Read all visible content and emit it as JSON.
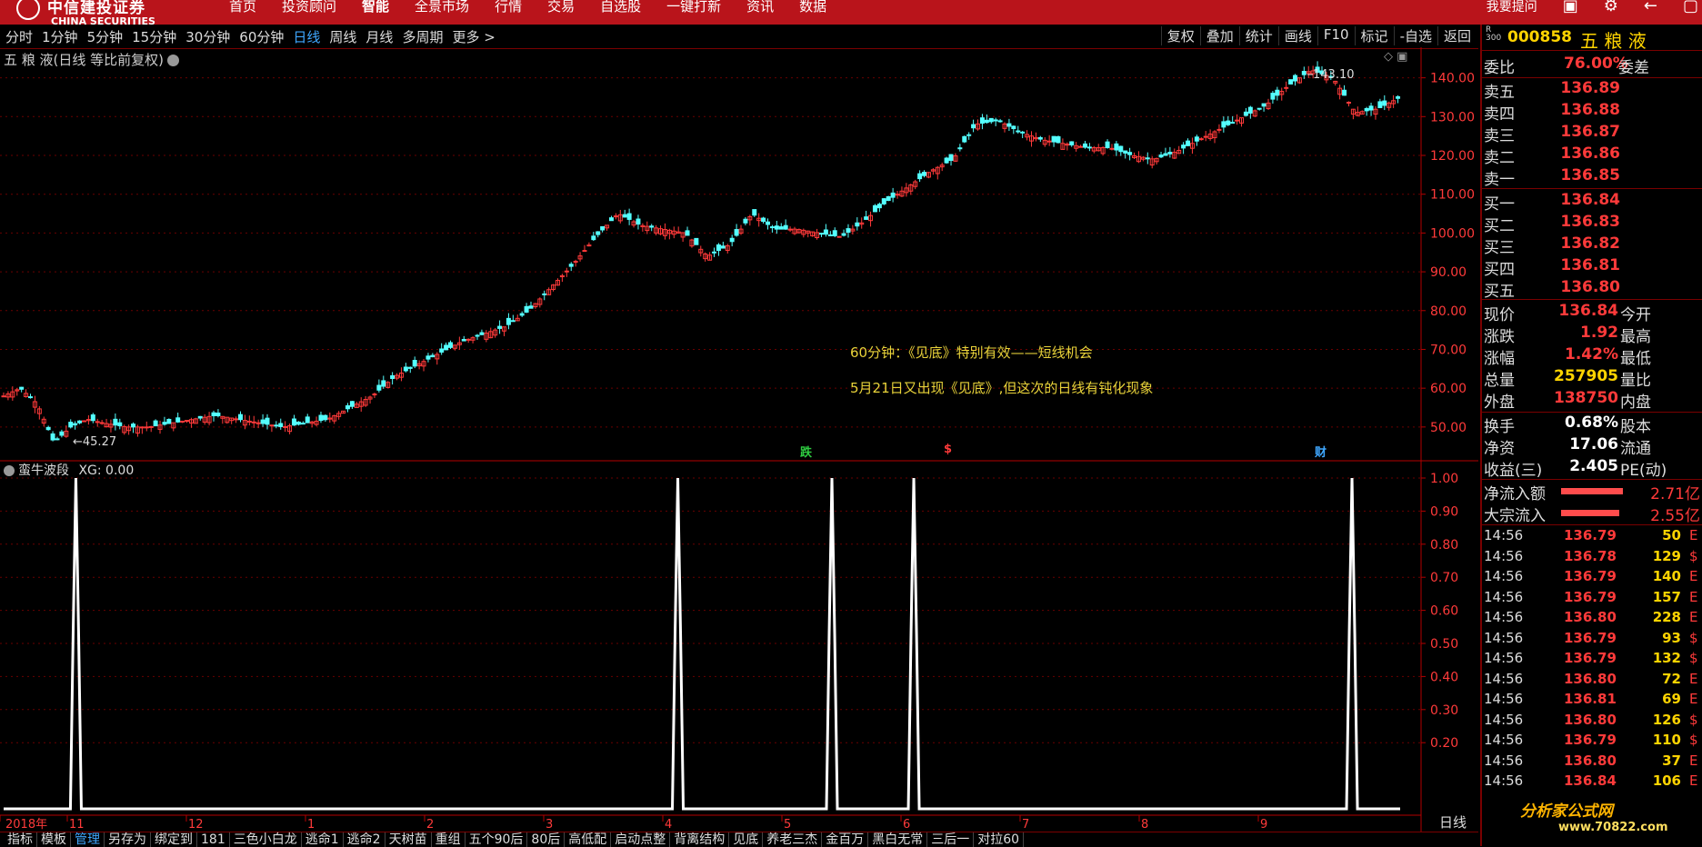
{
  "app": {
    "brand_cn": "中信建投证券",
    "brand_en": "CHINA SECURITIES",
    "menu": [
      "首页",
      "投资顾问",
      "智能",
      "全景市场",
      "行情",
      "交易",
      "自选股",
      "一键打新",
      "资讯",
      "数据"
    ],
    "help": "我要提问"
  },
  "toolbar": {
    "periods": [
      "分时",
      "1分钟",
      "5分钟",
      "15分钟",
      "30分钟",
      "60分钟",
      "日线",
      "周线",
      "月线",
      "多周期",
      "更多 >"
    ],
    "active_period": "日线",
    "right_tools": [
      "复权",
      "叠加",
      "统计",
      "画线",
      "F10",
      "标记",
      "-自选",
      "返回"
    ]
  },
  "chart": {
    "title": "五 粮 液(日线 等比前复权)",
    "price_axis": [
      "140.00",
      "130.00",
      "120.00",
      "110.00",
      "100.00",
      "90.00",
      "80.00",
      "70.00",
      "60.00",
      "50.00"
    ],
    "high_label": "143.10",
    "low_label": "45.27",
    "annotations": [
      "60分钟：《见底》特别有效——短线机会",
      "5月21日又出现《见底》,但这次的日线有钝化现象"
    ],
    "markers": [
      {
        "text": "跌",
        "color": "#2ecc40"
      },
      {
        "text": "$",
        "color": "#ff3a3a"
      },
      {
        "text": "财",
        "color": "#3fa7ff"
      }
    ],
    "date_axis": [
      "2018年",
      "11",
      "12",
      "1",
      "2",
      "3",
      "4",
      "5",
      "6",
      "7",
      "8",
      "9"
    ],
    "period_label": "日线"
  },
  "chart_data": [
    {
      "type": "candlestick",
      "title": "五 粮 液(日线 等比前复权)",
      "ylim": [
        42,
        146
      ],
      "x": [
        "2018-10",
        "2018-11",
        "2018-12",
        "2019-01",
        "2019-02",
        "2019-03",
        "2019-04",
        "2019-05",
        "2019-06",
        "2019-07",
        "2019-08",
        "2019-09"
      ],
      "close_path": [
        [
          0,
          58
        ],
        [
          3,
          60
        ],
        [
          6,
          56
        ],
        [
          9,
          46
        ],
        [
          12,
          50
        ],
        [
          15,
          52
        ],
        [
          18,
          51
        ],
        [
          22,
          50
        ],
        [
          26,
          50
        ],
        [
          30,
          51
        ],
        [
          34,
          52
        ],
        [
          38,
          53
        ],
        [
          42,
          52
        ],
        [
          46,
          51
        ],
        [
          50,
          50
        ],
        [
          54,
          51
        ],
        [
          58,
          52
        ],
        [
          62,
          55
        ],
        [
          66,
          58
        ],
        [
          70,
          63
        ],
        [
          74,
          66
        ],
        [
          78,
          69
        ],
        [
          82,
          72
        ],
        [
          86,
          74
        ],
        [
          90,
          76
        ],
        [
          94,
          80
        ],
        [
          98,
          86
        ],
        [
          102,
          92
        ],
        [
          106,
          99
        ],
        [
          110,
          105
        ],
        [
          114,
          102
        ],
        [
          118,
          101
        ],
        [
          122,
          100
        ],
        [
          126,
          94
        ],
        [
          130,
          97
        ],
        [
          134,
          105
        ],
        [
          138,
          101
        ],
        [
          142,
          101
        ],
        [
          146,
          100
        ],
        [
          150,
          99
        ],
        [
          154,
          103
        ],
        [
          158,
          108
        ],
        [
          162,
          112
        ],
        [
          166,
          116
        ],
        [
          170,
          119
        ],
        [
          174,
          128
        ],
        [
          178,
          129
        ],
        [
          182,
          126
        ],
        [
          186,
          124
        ],
        [
          190,
          123
        ],
        [
          194,
          122
        ],
        [
          198,
          122
        ],
        [
          202,
          120
        ],
        [
          206,
          119
        ],
        [
          210,
          121
        ],
        [
          214,
          124
        ],
        [
          218,
          127
        ],
        [
          222,
          130
        ],
        [
          226,
          133
        ],
        [
          230,
          138
        ],
        [
          234,
          142
        ],
        [
          238,
          140
        ],
        [
          242,
          131
        ],
        [
          246,
          132
        ],
        [
          250,
          135
        ]
      ]
    },
    {
      "type": "line",
      "name": "XG",
      "ylim": [
        0,
        1.0
      ],
      "spikes_at_x": [
        15,
        140,
        172,
        189,
        280
      ]
    }
  ],
  "indicator": {
    "title": "蛮牛波段",
    "xg_label": "XG: 0.00",
    "axis": [
      "1.00",
      "0.90",
      "0.80",
      "0.70",
      "0.60",
      "0.50",
      "0.40",
      "0.30",
      "0.20"
    ]
  },
  "bottom_tabs": [
    "指标",
    "模板",
    "管理",
    "另存为",
    "绑定到",
    "181",
    "三色小白龙",
    "逃命1",
    "逃命2",
    "天树苗",
    "重组",
    "五个90后",
    "80后",
    "高低配",
    "启动点整",
    "背离结构",
    "见底",
    "养老三杰",
    "金百万",
    "黑白无常",
    "三后一",
    "对拉60"
  ],
  "active_tab": "管理",
  "quote": {
    "code": "000858",
    "name": "五 粮 液",
    "ratio_label": "委比",
    "ratio": "76.00%",
    "diff_label": "委差",
    "sell": [
      {
        "label": "卖五",
        "price": "136.89"
      },
      {
        "label": "卖四",
        "price": "136.88"
      },
      {
        "label": "卖三",
        "price": "136.87"
      },
      {
        "label": "卖二",
        "price": "136.86"
      },
      {
        "label": "卖一",
        "price": "136.85"
      }
    ],
    "buy": [
      {
        "label": "买一",
        "price": "136.84"
      },
      {
        "label": "买二",
        "price": "136.83"
      },
      {
        "label": "买三",
        "price": "136.82"
      },
      {
        "label": "买四",
        "price": "136.81"
      },
      {
        "label": "买五",
        "price": "136.80"
      }
    ],
    "stats": [
      {
        "label": "现价",
        "value": "136.84",
        "label2": "今开"
      },
      {
        "label": "涨跌",
        "value": "1.92",
        "label2": "最高"
      },
      {
        "label": "涨幅",
        "value": "1.42%",
        "label2": "最低"
      },
      {
        "label": "总量",
        "value": "257905",
        "label2": "量比"
      },
      {
        "label": "外盘",
        "value": "138750",
        "label2": "内盘"
      }
    ],
    "stats2": [
      {
        "label": "换手",
        "value": "0.68%",
        "label2": "股本"
      },
      {
        "label": "净资",
        "value": "17.06",
        "label2": "流通"
      },
      {
        "label": "收益(三)",
        "value": "2.405",
        "label2": "PE(动)"
      }
    ],
    "flows": [
      {
        "label": "净流入额",
        "value": "2.71亿",
        "bar": 0.85
      },
      {
        "label": "大宗流入",
        "value": "2.55亿",
        "bar": 0.8
      }
    ],
    "ticks": [
      {
        "t": "14:56",
        "p": "136.79",
        "v": "50",
        "b": "E"
      },
      {
        "t": "14:56",
        "p": "136.78",
        "v": "129",
        "b": "$"
      },
      {
        "t": "14:56",
        "p": "136.79",
        "v": "140",
        "b": "E"
      },
      {
        "t": "14:56",
        "p": "136.79",
        "v": "157",
        "b": "E"
      },
      {
        "t": "14:56",
        "p": "136.80",
        "v": "228",
        "b": "E"
      },
      {
        "t": "14:56",
        "p": "136.79",
        "v": "93",
        "b": "$"
      },
      {
        "t": "14:56",
        "p": "136.79",
        "v": "132",
        "b": "$"
      },
      {
        "t": "14:56",
        "p": "136.80",
        "v": "72",
        "b": "E"
      },
      {
        "t": "14:56",
        "p": "136.81",
        "v": "69",
        "b": "E"
      },
      {
        "t": "14:56",
        "p": "136.80",
        "v": "126",
        "b": "$"
      },
      {
        "t": "14:56",
        "p": "136.79",
        "v": "110",
        "b": "$"
      },
      {
        "t": "14:56",
        "p": "136.80",
        "v": "37",
        "b": "E"
      },
      {
        "t": "14:56",
        "p": "136.84",
        "v": "106",
        "b": "E"
      }
    ]
  },
  "watermark": {
    "name": "分析家公式网",
    "url": "www.70822.com"
  }
}
